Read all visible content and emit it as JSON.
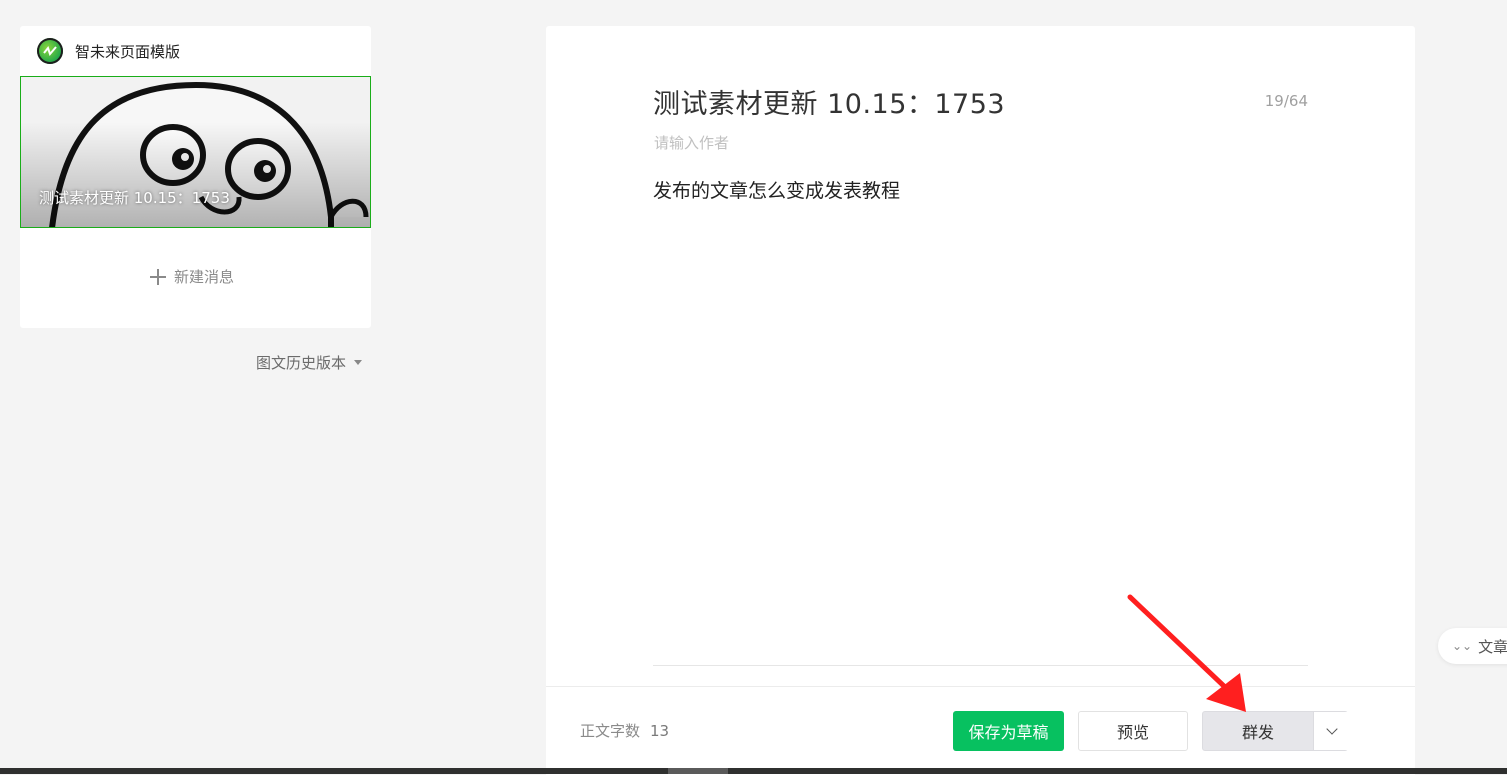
{
  "sidebar": {
    "account_name": "智未来页面模版",
    "cover_title": "测试素材更新 10.15：1753",
    "new_message_label": "新建消息",
    "history_label": "图文历史版本"
  },
  "editor": {
    "title": "测试素材更新   10.15：1753",
    "title_count": "19/64",
    "author_placeholder": "请输入作者",
    "body": "发布的文章怎么变成发表教程"
  },
  "footer": {
    "wordcount_label": "正文字数",
    "wordcount_value": "13",
    "save_label": "保存为草稿",
    "preview_label": "预览",
    "mass_send_label": "群发"
  },
  "float_tab": {
    "label": "文章"
  },
  "colors": {
    "accent_green": "#07c160",
    "annotation_red": "#ff1f1f"
  }
}
